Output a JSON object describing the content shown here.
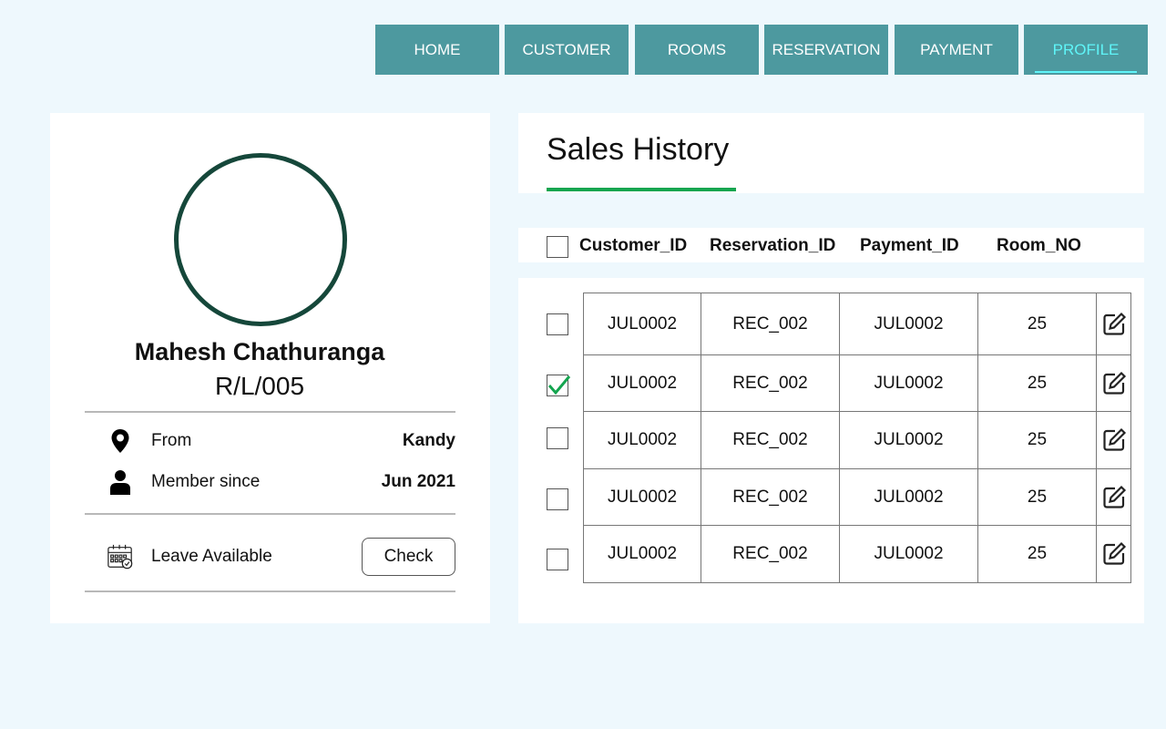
{
  "nav": [
    {
      "label": "HOME",
      "active": false
    },
    {
      "label": "CUSTOMER",
      "active": false
    },
    {
      "label": "ROOMS",
      "active": false
    },
    {
      "label": "RESERVATION",
      "active": false
    },
    {
      "label": "PAYMENT",
      "active": false
    },
    {
      "label": "PROFILE",
      "active": true
    }
  ],
  "profile": {
    "name": "Mahesh Chathuranga",
    "id": "R/L/005",
    "from_label": "From",
    "from_value": "Kandy",
    "member_label": "Member since",
    "member_value": "Jun 2021",
    "leave_label": "Leave Available",
    "check_label": "Check"
  },
  "sales": {
    "title": "Sales History",
    "columns": [
      "Customer_ID",
      "Reservation_ID",
      "Payment_ID",
      "Room_NO"
    ],
    "rows": [
      {
        "customer_id": "JUL0002",
        "reservation_id": "REC_002",
        "payment_id": "JUL0002",
        "room_no": "25",
        "checked": false
      },
      {
        "customer_id": "JUL0002",
        "reservation_id": "REC_002",
        "payment_id": "JUL0002",
        "room_no": "25",
        "checked": true
      },
      {
        "customer_id": "JUL0002",
        "reservation_id": "REC_002",
        "payment_id": "JUL0002",
        "room_no": "25",
        "checked": false
      },
      {
        "customer_id": "JUL0002",
        "reservation_id": "REC_002",
        "payment_id": "JUL0002",
        "room_no": "25",
        "checked": false
      },
      {
        "customer_id": "JUL0002",
        "reservation_id": "REC_002",
        "payment_id": "JUL0002",
        "room_no": "25",
        "checked": false
      }
    ]
  },
  "icons": {
    "location": "map-pin-icon",
    "member": "user-icon",
    "leave": "calendar-check-icon",
    "edit": "edit-icon",
    "check": "checkmark-icon"
  },
  "colors": {
    "background": "#eef8fd",
    "nav": "#4d999f",
    "nav_active_text": "#5ff5f8",
    "avatar_ring": "#15473a",
    "accent_green": "#14a54f"
  }
}
